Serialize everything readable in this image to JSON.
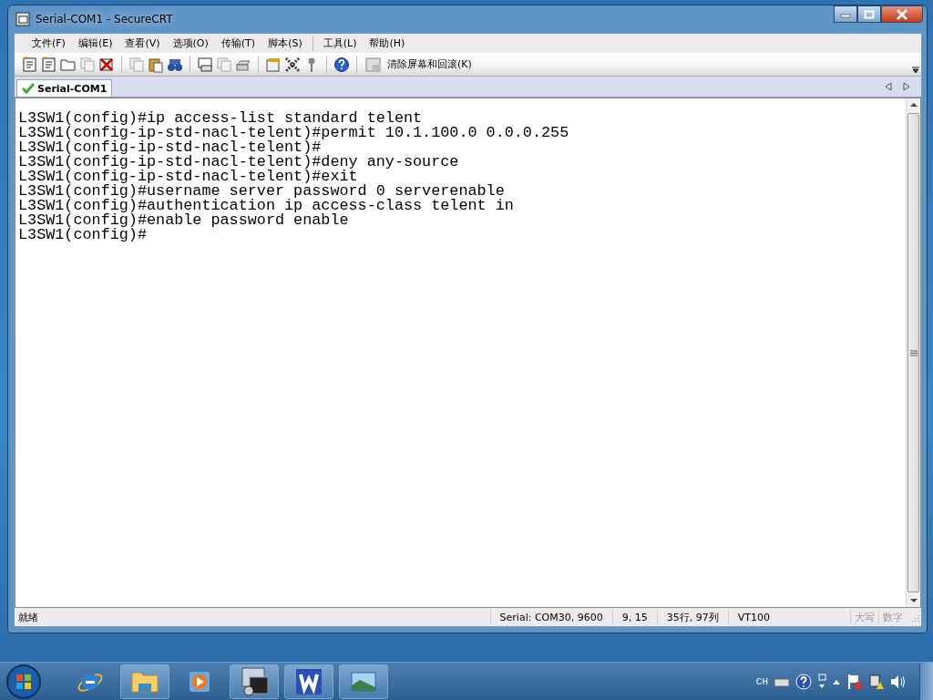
{
  "window": {
    "title": "Serial-COM1 - SecureCRT"
  },
  "menu": [
    "文件(F)",
    "编辑(E)",
    "查看(V)",
    "选项(O)",
    "传输(T)",
    "脚本(S)",
    "工具(L)",
    "帮助(H)"
  ],
  "toolbar": {
    "clear_button": "清除屏幕和回滚(K)"
  },
  "tabs": [
    {
      "label": "Serial-COM1",
      "selected": true,
      "connected": true
    }
  ],
  "terminal": {
    "lines": [
      "L3SW1(config)#ip access-list standard telent",
      "L3SW1(config-ip-std-nacl-telent)#permit 10.1.100.0 0.0.0.255",
      "L3SW1(config-ip-std-nacl-telent)#",
      "L3SW1(config-ip-std-nacl-telent)#deny any-source",
      "L3SW1(config-ip-std-nacl-telent)#exit",
      "L3SW1(config)#username server password 0 serverenable",
      "L3SW1(config)#authentication ip access-class telent in",
      "L3SW1(config)#enable password enable",
      "L3SW1(config)#"
    ]
  },
  "status_bar": {
    "message": "就绪",
    "connection": "Serial: COM30, 9600",
    "cursor": "9,  15",
    "size": "35行, 97列",
    "emulation": "VT100",
    "indicators": [
      {
        "label": "大写",
        "active": false
      },
      {
        "label": "数字",
        "active": false
      }
    ]
  },
  "taskbar": {
    "items": [
      {
        "kind": "browser",
        "running": false
      },
      {
        "kind": "folder",
        "running": true
      },
      {
        "kind": "media",
        "running": false
      },
      {
        "kind": "terminal",
        "running": true
      },
      {
        "kind": "writer",
        "running": true
      },
      {
        "kind": "photo",
        "running": true
      }
    ],
    "language": "CH"
  }
}
